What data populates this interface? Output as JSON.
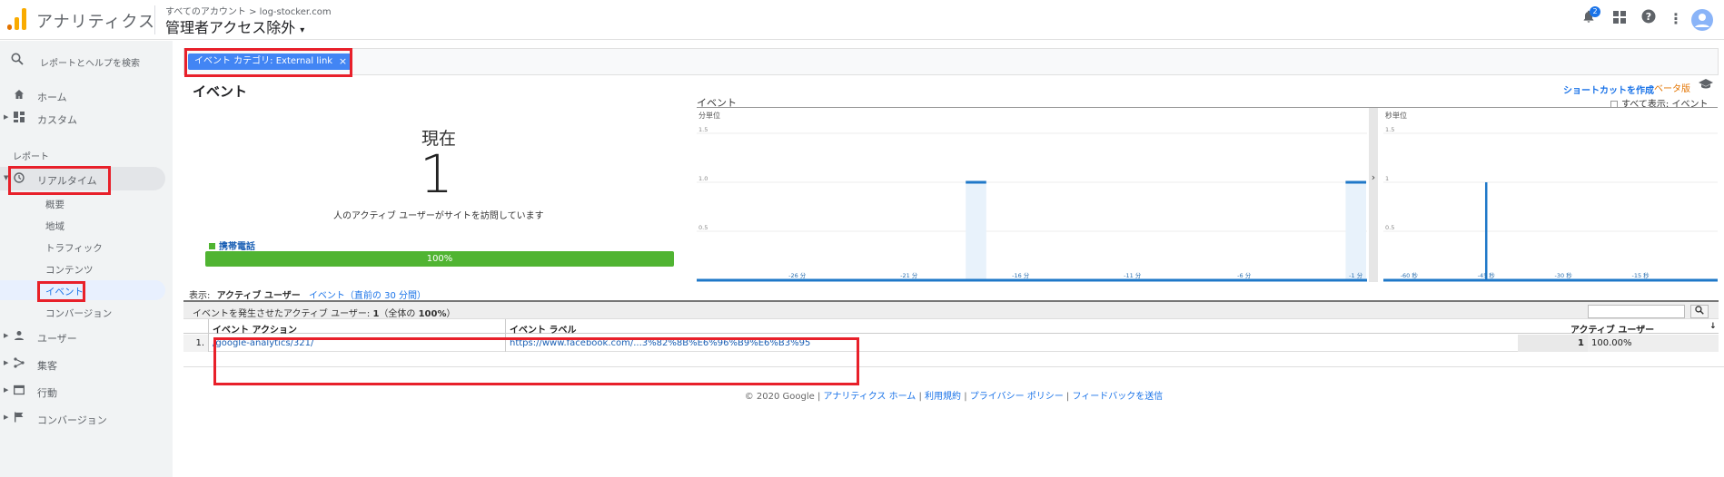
{
  "header": {
    "app_name": "アナリティクス",
    "breadcrumb_root": "すべてのアカウント",
    "breadcrumb_sep": ">",
    "breadcrumb_property": "log-stocker.com",
    "view_name": "管理者アクセス除外",
    "notification_count": "2"
  },
  "sidebar": {
    "search_placeholder": "レポートとヘルプを検索",
    "home": "ホーム",
    "custom": "カスタム",
    "reports_label": "レポート",
    "realtime": "リアルタイム",
    "realtime_sub": [
      "概要",
      "地域",
      "トラフィック",
      "コンテンツ",
      "イベント",
      "コンバージョン"
    ],
    "audience": "ユーザー",
    "acquisition": "集客",
    "behavior": "行動",
    "conversions": "コンバージョン"
  },
  "filter": {
    "chip_label": "イベント カテゴリ: External link",
    "chip_close": "×"
  },
  "page": {
    "title": "イベント",
    "shortcut": "ショートカットを作成",
    "beta": "ベータ版"
  },
  "now": {
    "label": "現在",
    "value": "1",
    "subtitle": "人のアクティブ ユーザーがサイトを訪問しています",
    "device_label": "携帯電話",
    "device_percent": "100%",
    "device_fraction": 1.0,
    "device_color": "#50b432"
  },
  "chart_data": [
    {
      "type": "bar",
      "title": "イベント",
      "subtitle": "分単位",
      "ylim": [
        0,
        1.5
      ],
      "y_ticks": [
        "1.5",
        "1.0",
        "0.5"
      ],
      "x_ticks": [
        "-26 分",
        "-21 分",
        "-16 分",
        "-11 分",
        "-6 分",
        "-1 分"
      ],
      "x": [
        -30,
        -29,
        -28,
        -27,
        -26,
        -25,
        -24,
        -23,
        -22,
        -21,
        -20,
        -19,
        -18,
        -17,
        -16,
        -15,
        -14,
        -13,
        -12,
        -11,
        -10,
        -9,
        -8,
        -7,
        -6,
        -5,
        -4,
        -3,
        -2,
        -1
      ],
      "values": [
        0,
        0,
        0,
        0,
        0,
        0,
        0,
        0,
        0,
        0,
        0,
        0,
        1,
        0,
        0,
        0,
        0,
        0,
        0,
        0,
        0,
        0,
        0,
        0,
        0,
        0,
        0,
        0,
        0,
        1
      ]
    },
    {
      "type": "bar",
      "subtitle": "秒単位",
      "ylim": [
        0,
        1.5
      ],
      "y_ticks": [
        "1.5",
        "1",
        "0.5"
      ],
      "x_ticks": [
        "-60 秒",
        "-45 秒",
        "-30 秒",
        "-15 秒"
      ],
      "x": [
        -60,
        -45,
        -30,
        -15
      ],
      "spike_at": -45,
      "spike_value": 1
    }
  ],
  "show_all": "すべて表示: イベント",
  "view_toggle": {
    "label": "表示:",
    "selected": "アクティブ ユーザー",
    "other": "イベント（直前の 30 分間）"
  },
  "info": {
    "text_prefix": "イベントを発生させたアクティブ ユーザー: ",
    "count": "1",
    "text_suffix": "（全体の ",
    "pct": "100%",
    "close": "）"
  },
  "table": {
    "headers": [
      "イベント アクション",
      "イベント ラベル",
      "アクティブ ユーザー"
    ],
    "rows": [
      {
        "index": "1.",
        "action": "/google-analytics/321/",
        "label": "https://www.facebook.com/...3%82%8B%E6%96%B9%E6%B3%95",
        "users": "1",
        "percent": "100.00%"
      }
    ]
  },
  "footer": {
    "copyright": "© 2020 Google",
    "links": [
      "アナリティクス ホーム",
      "利用規約",
      "プライバシー ポリシー",
      "フィードバックを送信"
    ],
    "sep": " | "
  }
}
